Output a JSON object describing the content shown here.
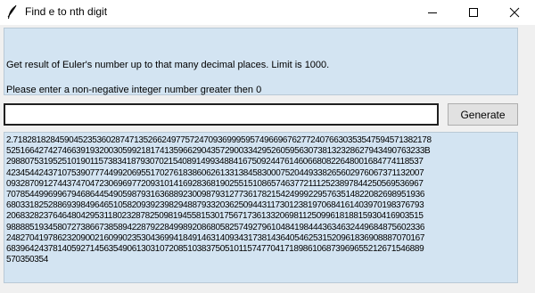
{
  "window": {
    "title": "Find e to nth digit",
    "icon": "feather-icon",
    "controls": [
      "minimize-icon",
      "maximize-icon",
      "close-icon"
    ]
  },
  "info": {
    "line1": "Get result of Euler's number up to that many decimal places. Limit is 1000.",
    "line2": "Please enter a non-negative integer number greater then 0"
  },
  "input": {
    "value": "",
    "placeholder": ""
  },
  "generate_label": "Generate",
  "output": {
    "lines": [
      "2.718281828459045235360287471352662497757247093699959574966967627724076630353547594571382178",
      "525166427427466391932003059921817413596629043572900334295260595630738132328627943490763233B",
      "298807531952510190115738341879307021540891499348841675092447614606680822648001684774118537",
      "423454424371075390777449920695517027618386062613313845830007520449338265602976067371132007",
      "093287091274437470472306969772093101416928368190255151086574637721112523897844250569536967",
      "707854499699679468644549059879316368892300987931277361782154249992295763514822082698951936",
      "680331825288693984964651058209392398294887933203625094431173012381970684161403970198376793",
      "206832823764648042953118023287825098194558153017567173613320698112509961818815930416903515",
      "988885193458072738667385894228792284998920868058257492796104841984443634632449684875602336",
      "248270419786232090021609902353043699418491463140934317381436405462531520961836908887070167",
      "683964243781405927145635490613031072085103837505101157477041718986106873969655212671546889",
      "570350354"
    ]
  }
}
